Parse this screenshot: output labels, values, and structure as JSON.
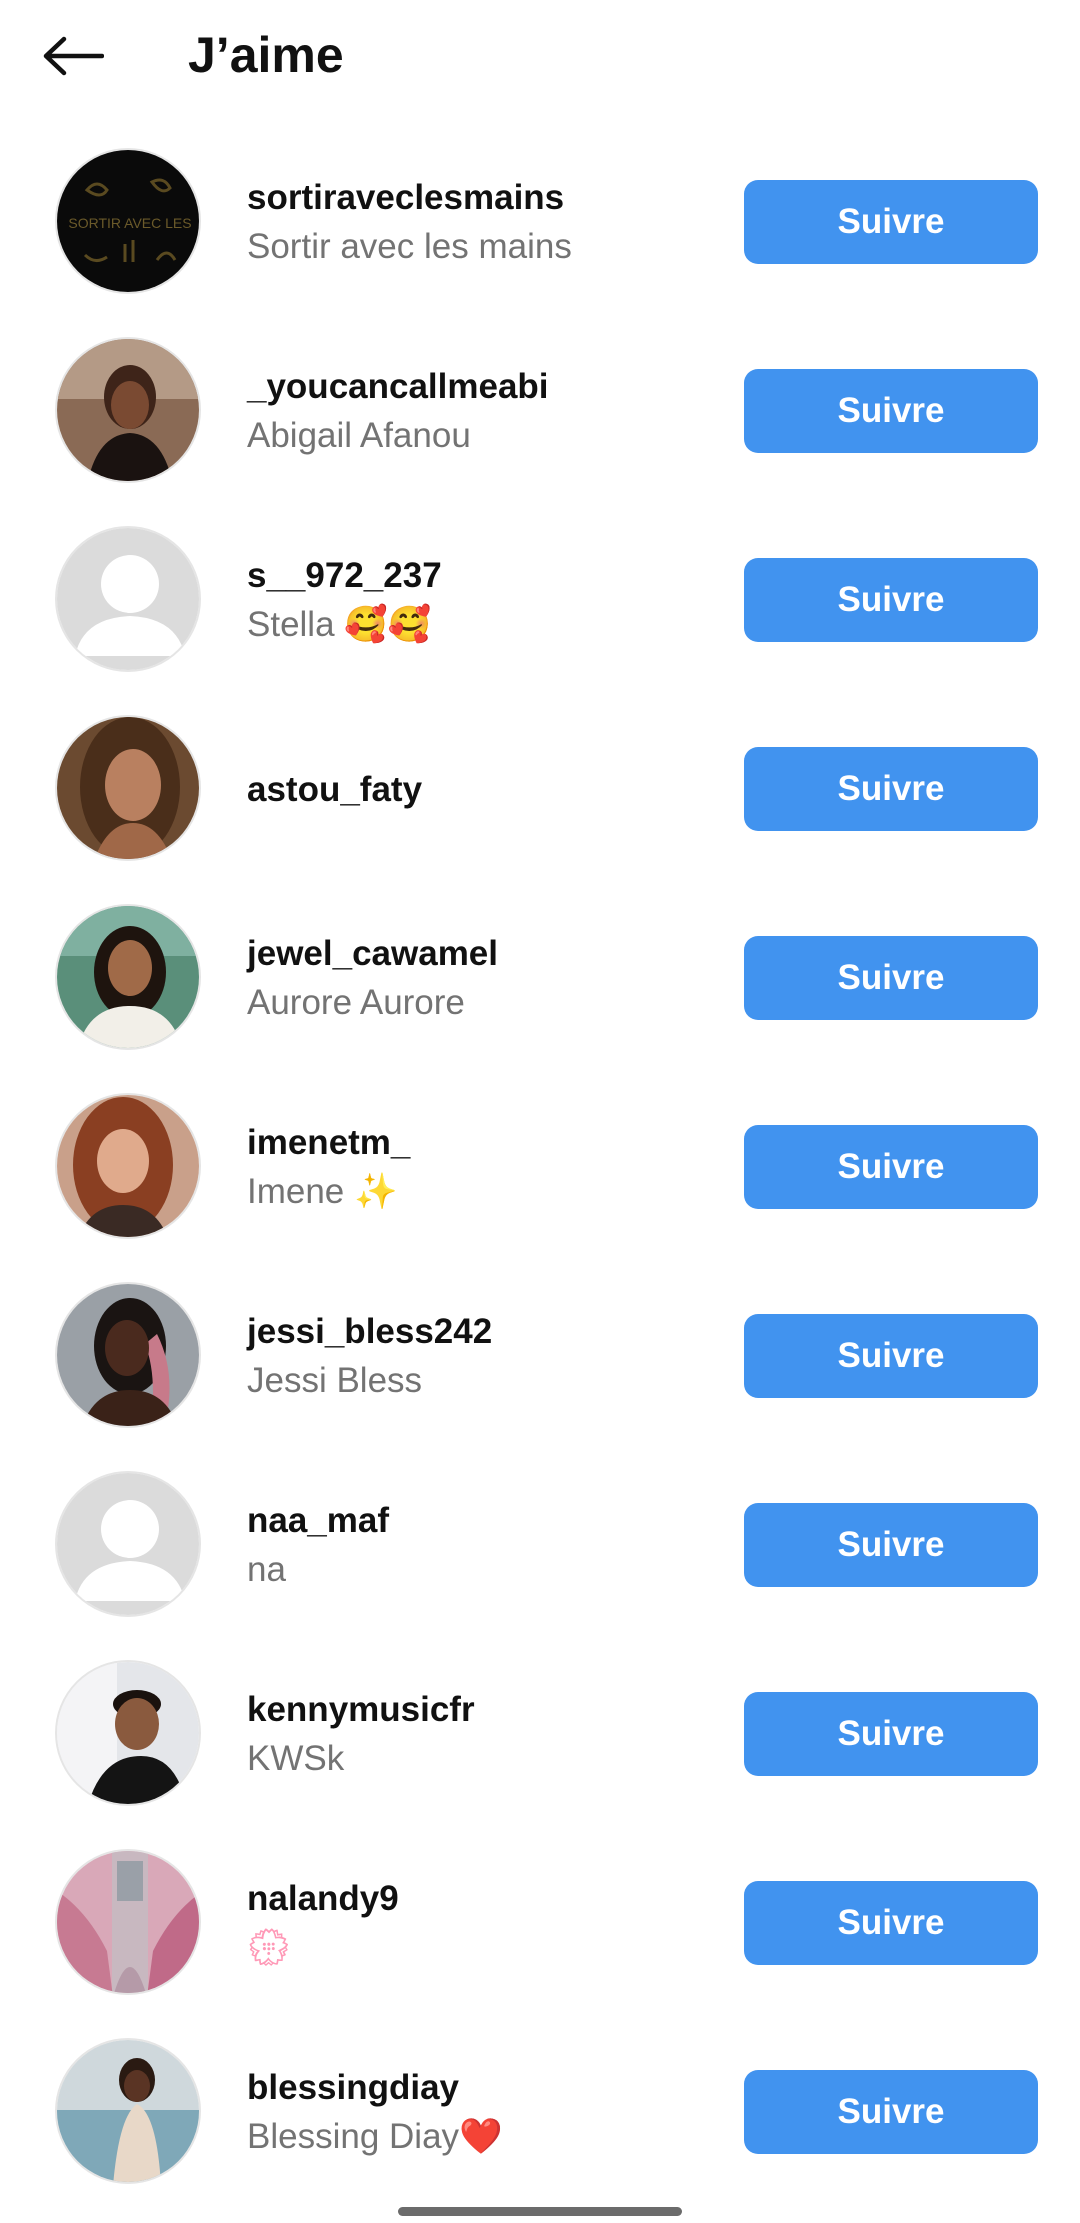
{
  "header": {
    "back_icon": "arrow-left-icon",
    "title": "J’aime"
  },
  "colors": {
    "follow_button": "#4193ef",
    "text_primary": "#111111",
    "text_secondary": "#737373"
  },
  "likers": [
    {
      "username": "sortiraveclesmains",
      "fullname": "Sortir avec les mains",
      "button": "Suivre",
      "avatar": "logo-hands"
    },
    {
      "username": "_youcancallmeabi",
      "fullname": "Abigail Afanou",
      "button": "Suivre",
      "avatar": "photo"
    },
    {
      "username": "s__972_237",
      "fullname": "Stella 🥰🥰",
      "button": "Suivre",
      "avatar": "default-user-icon"
    },
    {
      "username": "astou_faty",
      "fullname": "",
      "button": "Suivre",
      "avatar": "photo"
    },
    {
      "username": "jewel_cawamel",
      "fullname": "Aurore Aurore",
      "button": "Suivre",
      "avatar": "photo"
    },
    {
      "username": "imenetm_",
      "fullname": "Imene ✨",
      "button": "Suivre",
      "avatar": "photo"
    },
    {
      "username": "jessi_bless242",
      "fullname": "Jessi Bless",
      "button": "Suivre",
      "avatar": "photo"
    },
    {
      "username": "naa_maf",
      "fullname": "na",
      "button": "Suivre",
      "avatar": "default-user-icon"
    },
    {
      "username": "kennymusicfr",
      "fullname": "KWSk",
      "button": "Suivre",
      "avatar": "photo"
    },
    {
      "username": "nalandy9",
      "fullname": "💮",
      "button": "Suivre",
      "avatar": "photo"
    },
    {
      "username": "blessingdiay",
      "fullname": "Blessing Diay❤️",
      "button": "Suivre",
      "avatar": "photo"
    }
  ]
}
